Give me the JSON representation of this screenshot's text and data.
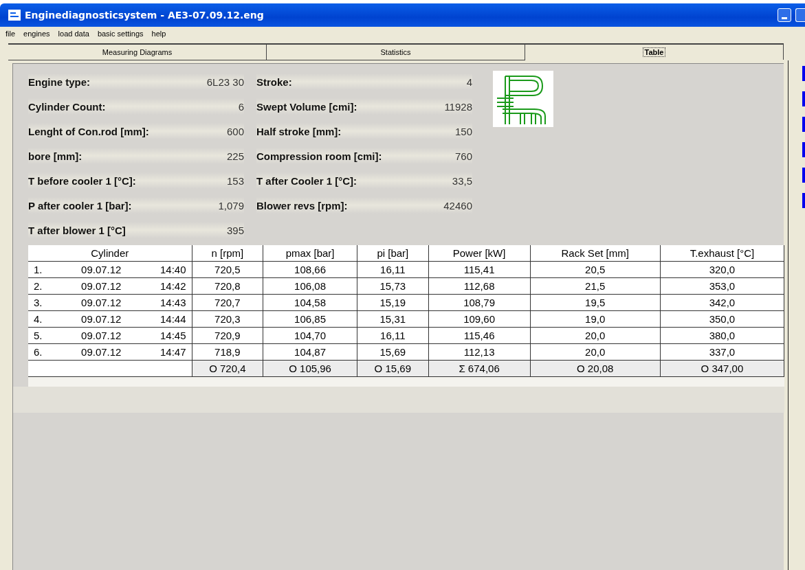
{
  "window": {
    "title": "Enginediagnosticsystem - AE3-07.09.12.eng"
  },
  "menu": [
    "file",
    "engines",
    "load data",
    "basic settings",
    "help"
  ],
  "tabs": [
    {
      "label": "Measuring Diagrams",
      "selected": false
    },
    {
      "label": "Statistics",
      "selected": false
    },
    {
      "label": "Table",
      "selected": true
    }
  ],
  "fields_left": [
    {
      "label": "Engine type:",
      "value": "6L23 30"
    },
    {
      "label": "Cylinder Count:",
      "value": "6"
    },
    {
      "label": "Lenght of Con.rod [mm]:",
      "value": "600"
    },
    {
      "label": "bore [mm]:",
      "value": "225"
    },
    {
      "label": "T before cooler 1 [°C]:",
      "value": "153"
    },
    {
      "label": "P after cooler 1 [bar]:",
      "value": "1,079"
    },
    {
      "label": "T after blower 1 [°C]",
      "value": "395"
    }
  ],
  "fields_right": [
    {
      "label": "Stroke:",
      "value": "4"
    },
    {
      "label": "Swept Volume [cmi]:",
      "value": "11928"
    },
    {
      "label": "Half stroke [mm]:",
      "value": "150"
    },
    {
      "label": "Compression room [cmi]:",
      "value": "760"
    },
    {
      "label": "T after Cooler 1 [°C]:",
      "value": "33,5"
    },
    {
      "label": "Blower revs [rpm]:",
      "value": "42460"
    }
  ],
  "table": {
    "columns": [
      "Cylinder",
      "n [rpm]",
      "pmax [bar]",
      "pi [bar]",
      "Power [kW]",
      "Rack Set [mm]",
      "T.exhaust [°C]"
    ],
    "rows": [
      {
        "number": "1.",
        "date": "09.07.12",
        "time": "14:40",
        "values": [
          "720,5",
          "108,66",
          "16,11",
          "115,41",
          "20,5",
          "320,0"
        ]
      },
      {
        "number": "2.",
        "date": "09.07.12",
        "time": "14:42",
        "values": [
          "720,8",
          "106,08",
          "15,73",
          "112,68",
          "21,5",
          "353,0"
        ]
      },
      {
        "number": "3.",
        "date": "09.07.12",
        "time": "14:43",
        "values": [
          "720,7",
          "104,58",
          "15,19",
          "108,79",
          "19,5",
          "342,0"
        ]
      },
      {
        "number": "4.",
        "date": "09.07.12",
        "time": "14:44",
        "values": [
          "720,3",
          "106,85",
          "15,31",
          "109,60",
          "19,0",
          "350,0"
        ]
      },
      {
        "number": "5.",
        "date": "09.07.12",
        "time": "14:45",
        "values": [
          "720,9",
          "104,70",
          "16,11",
          "115,46",
          "20,0",
          "380,0"
        ]
      },
      {
        "number": "6.",
        "date": "09.07.12",
        "time": "14:47",
        "values": [
          "718,9",
          "104,87",
          "15,69",
          "112,13",
          "20,0",
          "337,0"
        ]
      }
    ],
    "summary": [
      "O 720,4",
      "O 105,96",
      "O 15,69",
      "Σ 674,06",
      "O 20,08",
      "O 347,00"
    ]
  }
}
